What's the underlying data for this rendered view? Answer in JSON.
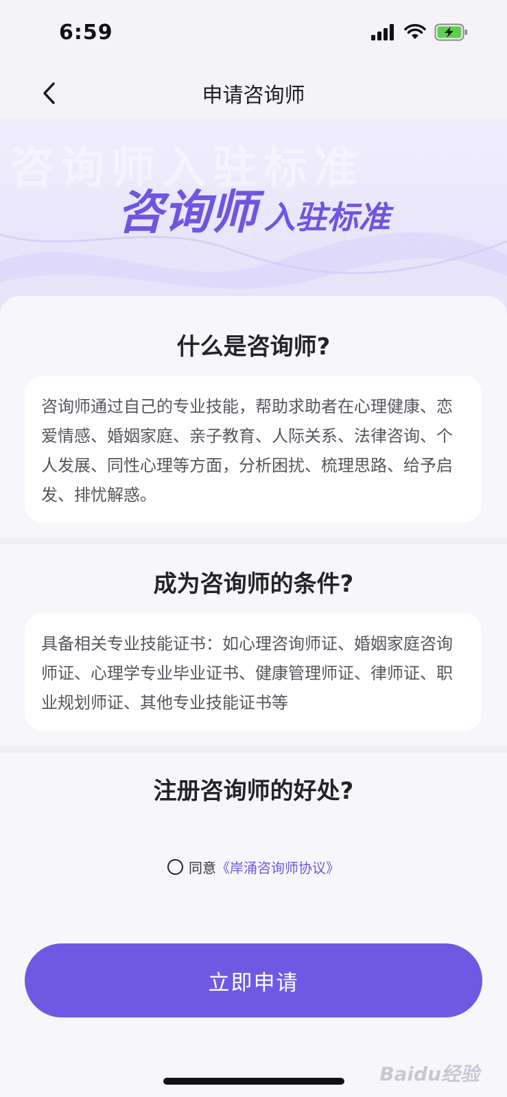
{
  "status": {
    "time": "6:59"
  },
  "nav": {
    "title": "申请咨询师"
  },
  "banner": {
    "title_big": "咨询师",
    "title_small": "入驻标准",
    "ghost_text": "咨询师入驻标准"
  },
  "sections": [
    {
      "title": "什么是咨询师?",
      "body": "咨询师通过自己的专业技能，帮助求助者在心理健康、恋爱情感、婚姻家庭、亲子教育、人际关系、法律咨询、个人发展、同性心理等方面，分析困扰、梳理思路、给予启发、排忧解惑。"
    },
    {
      "title": "成为咨询师的条件?",
      "body": "具备相关专业技能证书：如心理咨询师证、婚姻家庭咨询师证、心理学专业毕业证书、健康管理师证、律师证、职业规划师证、其他专业技能证书等"
    },
    {
      "title": "注册咨询师的好处?"
    }
  ],
  "agreement": {
    "prefix": "同意",
    "link": "《岸涌咨询师协议》"
  },
  "apply_button": "立即申请",
  "watermark": "Baidu经验",
  "colors": {
    "accent": "#7059e2",
    "highlight": "#b9a9f3",
    "banner_bg": "#e8e5fb"
  }
}
